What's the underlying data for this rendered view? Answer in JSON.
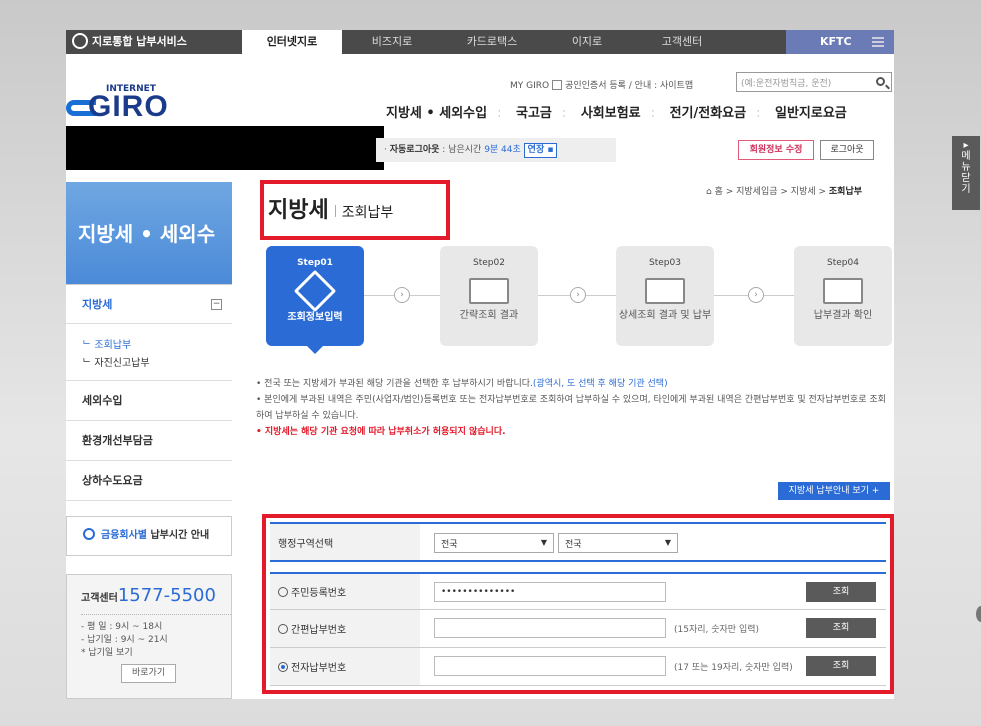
{
  "topbar": {
    "service": "지로통합 납부서비스",
    "tabs": [
      "인터넷지로",
      "비즈지로",
      "카드로택스",
      "이지로",
      "고객센터"
    ],
    "active_tab": "인터넷지로",
    "org": "KFTC"
  },
  "header": {
    "logo_small": "INTERNET",
    "logo_big": "GIRO",
    "util": "MY GIRO",
    "util_links": "공인인증서 등록 / 안내 : 사이트맵",
    "search_placeholder": "(예:운전자범칙금, 운전)",
    "gnav": [
      "지방세 • 세외수입",
      "국고금",
      "사회보험료",
      "전기/전화요금",
      "일반지로요금"
    ]
  },
  "session": {
    "label": "자동로그아웃",
    "remaining_prefix": ": 남은시간",
    "remaining_time": "9분 44초",
    "extend": "연장",
    "edit_member": "회원정보 수정",
    "logout": "로그아웃"
  },
  "sidebar": {
    "title": "지방세 • 세외수",
    "section": "지방세",
    "subs": [
      "ᄂ 조회납부",
      "ᄂ 자진신고납부"
    ],
    "items": [
      "세외수입",
      "환경개선부담금",
      "상하수도요금"
    ],
    "pay_time_prefix": "금융회사별",
    "pay_time": "납부시간 안내",
    "center_label": "고객센터",
    "center_phone": "1577-5500",
    "hours1": "- 평  일 : 9시 ~ 18시",
    "hours2": "- 납기일 : 9시 ~ 21시",
    "hours3": "* 납기일 보기",
    "go_button": "바로가기"
  },
  "main": {
    "title": "지방세",
    "subtitle": "조회납부",
    "breadcrumb_home": "홈",
    "breadcrumb": " > 지방세입금 > 지방세 > ",
    "breadcrumb_current": "조회납부",
    "steps": [
      {
        "num": "Step01",
        "label": "조회정보입력"
      },
      {
        "num": "Step02",
        "label": "간략조회 결과"
      },
      {
        "num": "Step03",
        "label": "상세조회 결과 및 납부"
      },
      {
        "num": "Step04",
        "label": "납부결과 확인"
      }
    ],
    "note1": "• 전국 또는 지방세가 부과된 해당 기관을 선택한 후 납부하시기 바랍니다.",
    "note1_blue": "(광역시, 도 선택 후 해당 기관 선택)",
    "note2": "• 본인에게 부과된 내역은 주민(사업자/법인)등록번호 또는 전자납부번호로 조회하여 납부하실 수 있으며, 타인에게 부과된 내역은 간편납부번호 및 전자납부번호로 조회하여 납부하실 수 있습니다.",
    "note3": "• 지방세는 해당 기관 요청에 따라 납부취소가 허용되지 않습니다.",
    "guide_button": "지방세 납부안내 보기 +"
  },
  "form": {
    "region_label": "행정구역선택",
    "region1": "전국",
    "region2": "전국",
    "id_label": "주민등록번호",
    "id_value": "••••••••••••••",
    "simple_label": "간편납부번호",
    "simple_hint": "(15자리, 숫자만 입력)",
    "elec_label": "전자납부번호",
    "elec_hint": "(17 또는 19자리, 숫자만 입력)",
    "query": "조회"
  },
  "menu_close": "메뉴닫기"
}
